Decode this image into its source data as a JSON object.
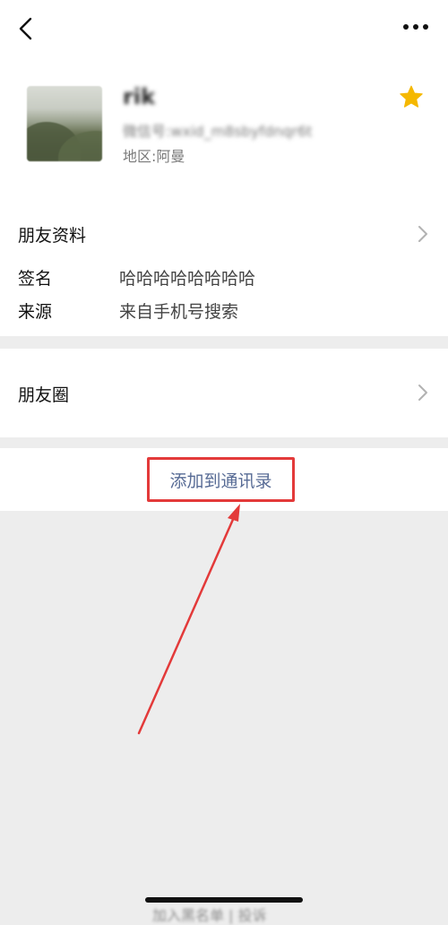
{
  "profile": {
    "name": "rik",
    "wechat_id_label": "微信号:",
    "wechat_id_value": "wxid_m8sbyfdnqr6t",
    "region_label": "地区:",
    "region_value": "阿曼"
  },
  "info": {
    "friend_profile_label": "朋友资料",
    "signature_label": "签名",
    "signature_value": "哈哈哈哈哈哈哈哈",
    "source_label": "来源",
    "source_value": "来自手机号搜索"
  },
  "moments": {
    "label": "朋友圈"
  },
  "actions": {
    "add_to_contacts": "添加到通讯录"
  },
  "footer": {
    "text": "加入黑名单 | 投诉"
  },
  "colors": {
    "link": "#576b95",
    "annotation": "#e33a3a",
    "star": "#f5b800"
  },
  "icons": {
    "back": "back-icon",
    "more": "more-icon",
    "star": "star-icon",
    "chevron": "chevron-right-icon"
  }
}
